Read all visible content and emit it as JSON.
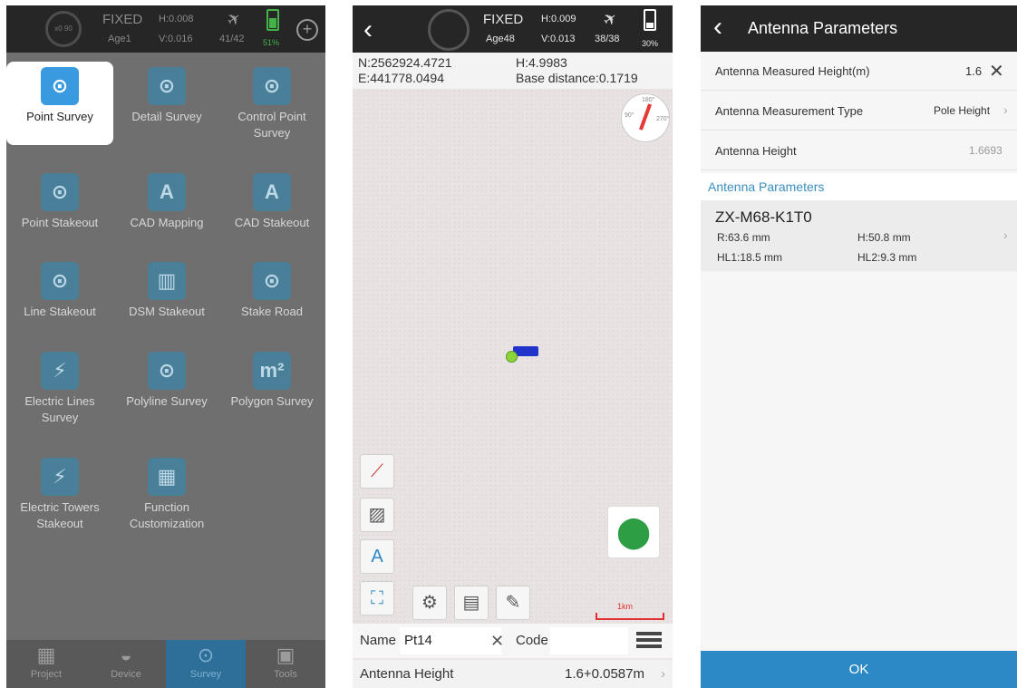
{
  "panel1": {
    "status": {
      "fix_state": "FIXED",
      "h_precision": "H:0.008",
      "v_precision": "V:0.016",
      "age": "Age1",
      "satellites": "41/42",
      "battery": "51%",
      "ring_label": "x0 90"
    },
    "tiles": [
      {
        "label": "Point Survey",
        "icon": "point-survey-icon",
        "glyph": "⊙"
      },
      {
        "label": "Detail Survey",
        "icon": "detail-survey-icon",
        "glyph": "⊙"
      },
      {
        "label": "Control Point Survey",
        "icon": "control-point-icon",
        "glyph": "⊙"
      },
      {
        "label": "Point Stakeout",
        "icon": "point-stakeout-icon",
        "glyph": "⊙"
      },
      {
        "label": "CAD Mapping",
        "icon": "cad-mapping-icon",
        "glyph": "A"
      },
      {
        "label": "CAD Stakeout",
        "icon": "cad-stakeout-icon",
        "glyph": "A"
      },
      {
        "label": "Line Stakeout",
        "icon": "line-stakeout-icon",
        "glyph": "⊙"
      },
      {
        "label": "DSM Stakeout",
        "icon": "dsm-stakeout-icon",
        "glyph": "▥"
      },
      {
        "label": "Stake Road",
        "icon": "stake-road-icon",
        "glyph": "⊙"
      },
      {
        "label": "Electric Lines Survey",
        "icon": "electric-lines-icon",
        "glyph": "⚡"
      },
      {
        "label": "Polyline Survey",
        "icon": "polyline-survey-icon",
        "glyph": "⊙"
      },
      {
        "label": "Polygon Survey",
        "icon": "polygon-survey-icon",
        "glyph": "m²"
      },
      {
        "label": "Electric Towers Stakeout",
        "icon": "electric-towers-icon",
        "glyph": "⚡"
      },
      {
        "label": "Function Customization",
        "icon": "function-customization-icon",
        "glyph": "▦"
      }
    ],
    "nav": [
      {
        "label": "Project",
        "icon": "project-icon",
        "glyph": "▦"
      },
      {
        "label": "Device",
        "icon": "device-icon",
        "glyph": "◒"
      },
      {
        "label": "Survey",
        "icon": "survey-icon",
        "glyph": "⊙"
      },
      {
        "label": "Tools",
        "icon": "tools-icon",
        "glyph": "▣"
      }
    ]
  },
  "panel2": {
    "status": {
      "fix_state": "FIXED",
      "h_precision": "H:0.009",
      "v_precision": "V:0.013",
      "age": "Age48",
      "satellites": "38/38",
      "battery": "30%"
    },
    "coords": {
      "n": "N:2562924.4721",
      "e": "E:441778.0494",
      "h": "H:4.9983",
      "base_distance": "Base distance:0.1719"
    },
    "compass": {
      "n": "180°",
      "w": "90°",
      "e": "270°"
    },
    "scale_label": "1km",
    "name_label": "Name",
    "name_value": "Pt14",
    "code_label": "Code",
    "antenna_label": "Antenna Height",
    "antenna_value": "1.6+0.0587m"
  },
  "panel3": {
    "title": "Antenna Parameters",
    "rows": [
      {
        "label": "Antenna Measured Height(m)",
        "value": "1.6"
      },
      {
        "label": "Antenna Measurement Type",
        "value": "Pole Height"
      },
      {
        "label": "Antenna Height",
        "value": "1.6693"
      }
    ],
    "section_title": "Antenna Parameters",
    "antenna": {
      "model": "ZX-M68-K1T0",
      "r": "R:63.6 mm",
      "h": "H:50.8 mm",
      "hl1": "HL1:18.5 mm",
      "hl2": "HL2:9.3 mm"
    },
    "ok_label": "OK"
  },
  "colors": {
    "accent": "#2d88c6",
    "status_bar": "#262626",
    "fixed_green": "#43b248"
  }
}
